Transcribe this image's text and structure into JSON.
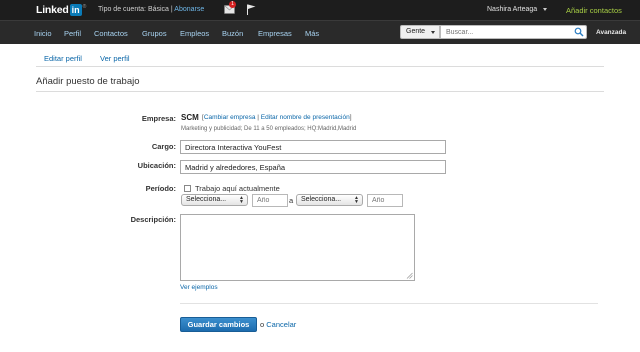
{
  "topbar": {
    "logo_text": "Linked",
    "logo_in": "in",
    "logo_reg": "®",
    "account_type": "Tipo de cuenta: Básica |",
    "upgrade": "Abonarse",
    "message_badge": "1",
    "user_name": "Nashira Arteaga",
    "add_contacts": "Añadir contactos"
  },
  "nav": {
    "items": [
      "Inicio",
      "Perfil",
      "Contactos",
      "Grupos",
      "Empleos",
      "Buzón",
      "Empresas",
      "Más"
    ],
    "search_scope": "Gente",
    "search_placeholder": "Buscar...",
    "advanced": "Avanzada"
  },
  "subtabs": {
    "edit_profile": "Editar perfil",
    "view_profile": "Ver perfil"
  },
  "form": {
    "title": "Añadir puesto de trabajo",
    "company_label": "Empresa:",
    "company_name": "SCM",
    "change_company": "Cambiar empresa",
    "edit_display_name": "Editar nombre de presentación",
    "company_desc": "Marketing y publicidad; De 11 a 50 empleados; HQ:Madrid,Madrid",
    "position_label": "Cargo:",
    "position_value": "Directora Interactiva YouFest",
    "location_label": "Ubicación:",
    "location_value": "Madrid y alrededores, España",
    "period_label": "Período:",
    "current_job": "Trabajo aquí actualmente",
    "select_placeholder": "Selecciona...",
    "year_placeholder": "Año",
    "to_sep": "a",
    "description_label": "Descripción:",
    "examples_link": "Ver ejemplos",
    "save_button": "Guardar cambios",
    "or_text": "o",
    "cancel_link": "Cancelar"
  },
  "colors": {
    "topbar_bg": "#1d1d1d",
    "nav_bg": "#2a2a2a",
    "nav_link": "#a9d4f2",
    "add_contacts": "#a8cf45",
    "link": "#0a66a8",
    "primary_button": "#1d6cae"
  }
}
